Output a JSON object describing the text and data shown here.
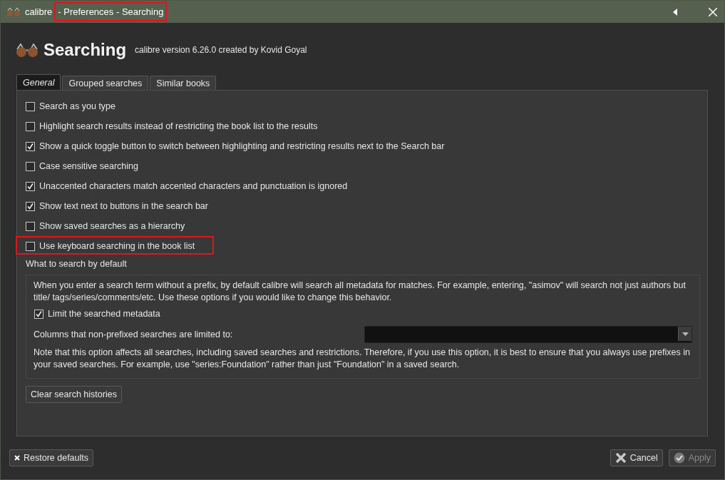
{
  "window": {
    "app": "calibre",
    "title": "- Preferences - Searching",
    "title_highlighted": true
  },
  "header": {
    "title": "Searching",
    "subtitle": "calibre version 6.26.0 created by Kovid Goyal"
  },
  "tabs": [
    {
      "label": "General",
      "selected": true
    },
    {
      "label": "Grouped searches",
      "selected": false
    },
    {
      "label": "Similar books",
      "selected": false
    }
  ],
  "options": [
    {
      "label": "Search as you type",
      "checked": false,
      "highlighted": false
    },
    {
      "label": "Highlight search results instead of restricting the book list to the results",
      "checked": false,
      "highlighted": false
    },
    {
      "label": "Show a quick toggle button to switch between highlighting and restricting results next to the Search bar",
      "checked": true,
      "highlighted": false
    },
    {
      "label": "Case sensitive searching",
      "checked": false,
      "highlighted": false
    },
    {
      "label": "Unaccented characters match accented characters and punctuation is ignored",
      "checked": true,
      "highlighted": false
    },
    {
      "label": "Show text next to buttons in the search bar",
      "checked": true,
      "highlighted": false
    },
    {
      "label": "Show saved searches as a hierarchy",
      "checked": false,
      "highlighted": false
    },
    {
      "label": "Use keyboard searching in the book list",
      "checked": false,
      "highlighted": true
    }
  ],
  "default_search": {
    "title": "What to search by default",
    "description": "When you enter a search term without a prefix, by default calibre will search all metadata for matches. For example, entering, \"asimov\" will search not just authors but title/ tags/series/comments/etc. Use these options if you would like to change this behavior.",
    "limit": {
      "label": "Limit the searched metadata",
      "checked": true
    },
    "columns_label": "Columns that non-prefixed searches are limited to:",
    "note": "Note that this option affects all searches, including saved searches and restrictions. Therefore, if you use this option, it is best to ensure that you always use prefixes in your saved searches. For example, use \"series:Foundation\" rather than just \"Foundation\" in a saved search."
  },
  "clear_button": "Clear search histories",
  "footer": {
    "restore": "Restore defaults",
    "cancel": "Cancel",
    "apply": {
      "label": "Apply",
      "disabled": true
    }
  }
}
